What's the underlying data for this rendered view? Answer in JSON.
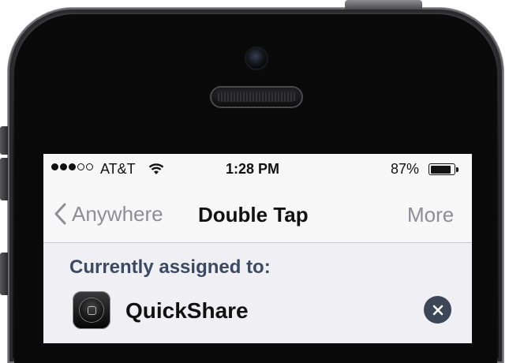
{
  "status_bar": {
    "carrier": "AT&T",
    "time": "1:28 PM",
    "battery_percent": "87%",
    "signal_bars_filled": 3,
    "signal_bars_total": 5,
    "battery_level": 0.87
  },
  "nav_bar": {
    "back_label": "Anywhere",
    "title": "Double Tap",
    "right_label": "More"
  },
  "section": {
    "header": "Currently assigned to:",
    "assigned_app": "QuickShare"
  },
  "icons": {
    "back": "chevron-left-icon",
    "wifi": "wifi-icon",
    "battery": "battery-icon",
    "app": "home-button-icon",
    "clear": "clear-x-icon"
  },
  "colors": {
    "nav_tint": "#8e8e93",
    "section_header": "#3b4a62",
    "clear_button": "#3d4657",
    "grouped_background": "#efeff4"
  }
}
